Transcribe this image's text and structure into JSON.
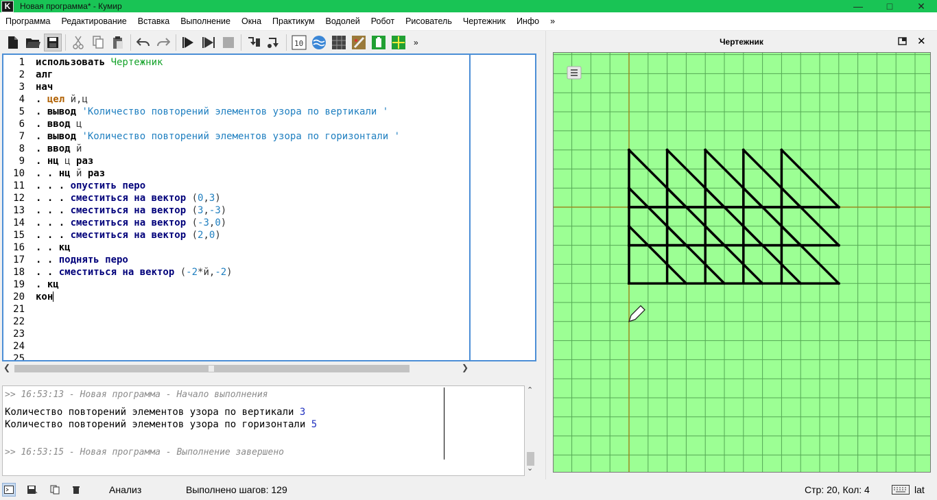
{
  "window": {
    "title": "Новая программа* - Кумир",
    "icon_letter": "K"
  },
  "menu": [
    "Программа",
    "Редактирование",
    "Вставка",
    "Выполнение",
    "Окна",
    "Практикум",
    "Водолей",
    "Робот",
    "Рисователь",
    "Чертежник",
    "Инфо",
    "»"
  ],
  "toolbar": {
    "overflow": "»"
  },
  "editor": {
    "line_numbers": [
      "1",
      "2",
      "3",
      "4",
      "5",
      "6",
      "7",
      "8",
      "9",
      "10",
      "11",
      "12",
      "13",
      "14",
      "15",
      "16",
      "17",
      "18",
      "19",
      "20",
      "21",
      "22",
      "23",
      "24",
      "25"
    ],
    "lines": [
      [
        {
          "t": "использовать ",
          "c": "kw"
        },
        {
          "t": "Чертежник",
          "c": "mod"
        }
      ],
      [
        {
          "t": "алг",
          "c": "kw"
        }
      ],
      [
        {
          "t": "нач",
          "c": "kw"
        }
      ],
      [
        {
          "t": ". ",
          "c": "kw"
        },
        {
          "t": "цел",
          "c": "ty"
        },
        {
          "t": " й,ц",
          "c": "var"
        }
      ],
      [
        {
          "t": ". ",
          "c": "kw"
        },
        {
          "t": "вывод",
          "c": "kw"
        },
        {
          "t": " ",
          "c": "var"
        },
        {
          "t": "'Количество повторений элементов узора по вертикали '",
          "c": "str"
        }
      ],
      [
        {
          "t": ". ",
          "c": "kw"
        },
        {
          "t": "ввод",
          "c": "kw"
        },
        {
          "t": " ц",
          "c": "var"
        }
      ],
      [
        {
          "t": ". ",
          "c": "kw"
        },
        {
          "t": "вывод",
          "c": "kw"
        },
        {
          "t": " ",
          "c": "var"
        },
        {
          "t": "'Количество повторений элементов узора по горизонтали '",
          "c": "str"
        }
      ],
      [
        {
          "t": ". ",
          "c": "kw"
        },
        {
          "t": "ввод",
          "c": "kw"
        },
        {
          "t": " й",
          "c": "var"
        }
      ],
      [
        {
          "t": ". ",
          "c": "kw"
        },
        {
          "t": "нц",
          "c": "kw"
        },
        {
          "t": " ц ",
          "c": "var"
        },
        {
          "t": "раз",
          "c": "kw"
        }
      ],
      [
        {
          "t": ". . ",
          "c": "kw"
        },
        {
          "t": "нц",
          "c": "kw"
        },
        {
          "t": " й ",
          "c": "var"
        },
        {
          "t": "раз",
          "c": "kw"
        }
      ],
      [
        {
          "t": ". . . ",
          "c": "kw"
        },
        {
          "t": "опустить перо",
          "c": "cmd"
        }
      ],
      [
        {
          "t": ". . . ",
          "c": "kw"
        },
        {
          "t": "сместиться на вектор",
          "c": "cmd"
        },
        {
          "t": " (",
          "c": "var"
        },
        {
          "t": "0",
          "c": "num"
        },
        {
          "t": ",",
          "c": "var"
        },
        {
          "t": "3",
          "c": "num"
        },
        {
          "t": ")",
          "c": "var"
        }
      ],
      [
        {
          "t": ". . . ",
          "c": "kw"
        },
        {
          "t": "сместиться на вектор",
          "c": "cmd"
        },
        {
          "t": " (",
          "c": "var"
        },
        {
          "t": "3",
          "c": "num"
        },
        {
          "t": ",",
          "c": "var"
        },
        {
          "t": "-3",
          "c": "num"
        },
        {
          "t": ")",
          "c": "var"
        }
      ],
      [
        {
          "t": ". . . ",
          "c": "kw"
        },
        {
          "t": "сместиться на вектор",
          "c": "cmd"
        },
        {
          "t": " (",
          "c": "var"
        },
        {
          "t": "-3",
          "c": "num"
        },
        {
          "t": ",",
          "c": "var"
        },
        {
          "t": "0",
          "c": "num"
        },
        {
          "t": ")",
          "c": "var"
        }
      ],
      [
        {
          "t": ". . . ",
          "c": "kw"
        },
        {
          "t": "сместиться на вектор",
          "c": "cmd"
        },
        {
          "t": " (",
          "c": "var"
        },
        {
          "t": "2",
          "c": "num"
        },
        {
          "t": ",",
          "c": "var"
        },
        {
          "t": "0",
          "c": "num"
        },
        {
          "t": ")",
          "c": "var"
        }
      ],
      [
        {
          "t": ". . ",
          "c": "kw"
        },
        {
          "t": "кц",
          "c": "kw"
        }
      ],
      [
        {
          "t": ". . ",
          "c": "kw"
        },
        {
          "t": "поднять перо",
          "c": "cmd"
        }
      ],
      [
        {
          "t": ". . ",
          "c": "kw"
        },
        {
          "t": "сместиться на вектор",
          "c": "cmd"
        },
        {
          "t": " (",
          "c": "var"
        },
        {
          "t": "-2",
          "c": "num"
        },
        {
          "t": "*й,",
          "c": "var"
        },
        {
          "t": "-2",
          "c": "num"
        },
        {
          "t": ")",
          "c": "var"
        }
      ],
      [
        {
          "t": ". ",
          "c": "kw"
        },
        {
          "t": "кц",
          "c": "kw"
        }
      ],
      [
        {
          "t": "кон",
          "c": "kw"
        }
      ]
    ]
  },
  "console": {
    "start": ">> 16:53:13 - Новая программа - Начало выполнения",
    "out1_text": "Количество повторений элементов узора по вертикали ",
    "out1_value": "3",
    "out2_text": "Количество повторений элементов узора по горизонтали ",
    "out2_value": "5",
    "end": ">> 16:53:15 - Новая программа - Выполнение завершено"
  },
  "drawer": {
    "title": "Чертежник",
    "rows": 3,
    "cols": 5,
    "pattern_vectors": [
      [
        0,
        3
      ],
      [
        3,
        -3
      ],
      [
        -3,
        0
      ],
      [
        2,
        0
      ]
    ],
    "row_shift": [
      -2,
      -2
    ],
    "colors": {
      "canvas": "#9cff94",
      "grid": "#55a855",
      "axes": "#9a8a20",
      "line": "#000000"
    }
  },
  "status": {
    "analysis": "Анализ",
    "steps": "Выполнено шагов: 129",
    "position": "Стр: 20, Кол: 4",
    "layout": "lat"
  }
}
